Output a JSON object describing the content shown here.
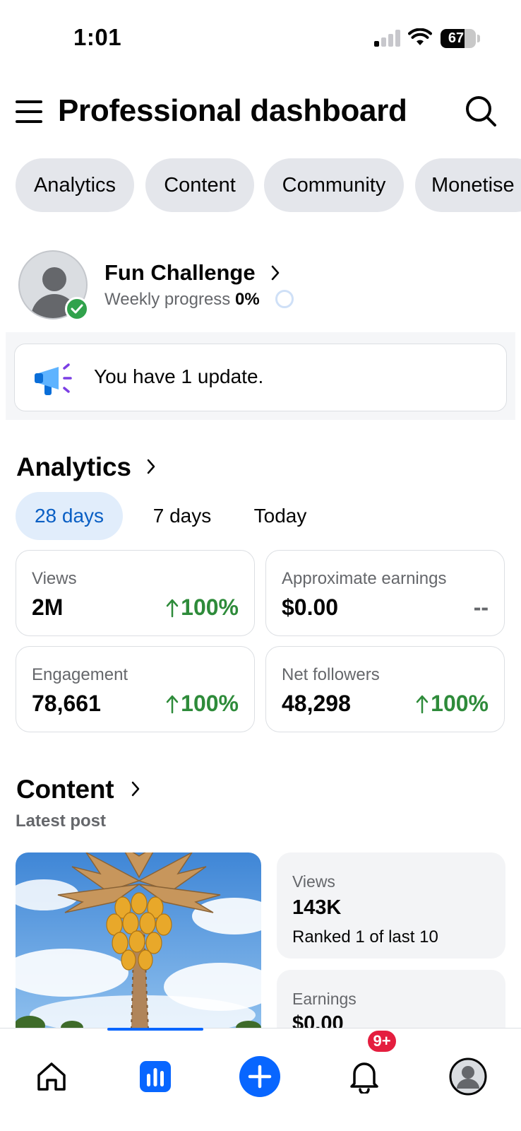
{
  "status_bar": {
    "time": "1:01",
    "battery": "67",
    "battery_level": 0.67
  },
  "header": {
    "title": "Professional dashboard"
  },
  "chips": [
    {
      "label": "Analytics"
    },
    {
      "label": "Content"
    },
    {
      "label": "Community"
    },
    {
      "label": "Monetise"
    }
  ],
  "challenge": {
    "title": "Fun Challenge",
    "progress_label": "Weekly progress",
    "progress_value": "0%"
  },
  "update": {
    "text": "You have 1 update."
  },
  "analytics": {
    "title": "Analytics",
    "tabs": [
      {
        "label": "28 days",
        "active": true
      },
      {
        "label": "7 days",
        "active": false
      },
      {
        "label": "Today",
        "active": false
      }
    ],
    "metrics": [
      {
        "label": "Views",
        "value": "2M",
        "change": "100%"
      },
      {
        "label": "Approximate earnings",
        "value": "$0.00",
        "change": "--"
      },
      {
        "label": "Engagement",
        "value": "78,661",
        "change": "100%"
      },
      {
        "label": "Net followers",
        "value": "48,298",
        "change": "100%"
      }
    ]
  },
  "content": {
    "title": "Content",
    "subtitle": "Latest post",
    "views": {
      "label": "Views",
      "value": "143K",
      "sub": "Ranked 1 of last 10"
    },
    "earnings": {
      "label": "Earnings",
      "value": "$0.00"
    }
  },
  "bottom_nav": {
    "items": [
      "home-icon",
      "dashboard-icon",
      "create-icon",
      "notifications-icon",
      "profile-icon"
    ],
    "notification_badge": "9+",
    "accent": "#0866ff"
  },
  "colors": {
    "positive": "#2e8b3a",
    "accent": "#0866ff",
    "chip_bg": "#e4e6eb",
    "badge": "#e41e3f"
  }
}
